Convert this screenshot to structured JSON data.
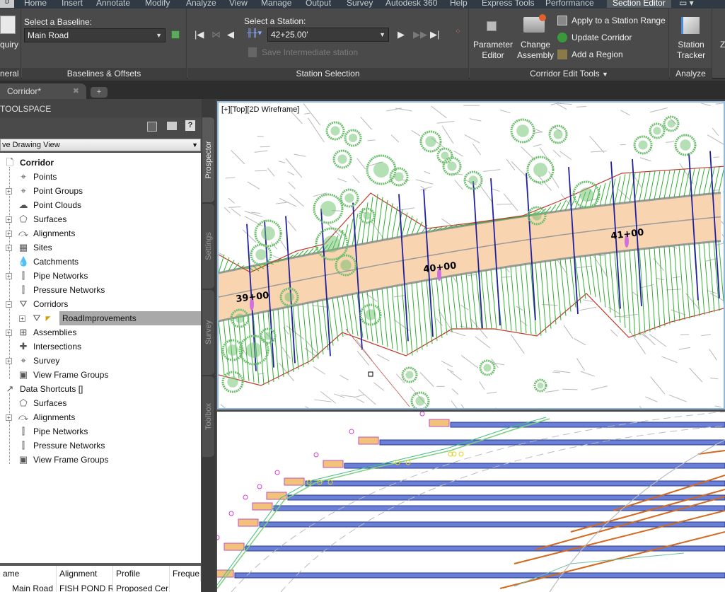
{
  "ribbon_tabs": [
    "Home",
    "Insert",
    "Annotate",
    "Modify",
    "Analyze",
    "View",
    "Manage",
    "Output",
    "Survey",
    "Autodesk 360",
    "Help",
    "Express Tools",
    "Performance",
    "Section Editor"
  ],
  "active_tab": "Section Editor",
  "app_button_label": "D",
  "panels": {
    "general": {
      "title": "neral",
      "button_label": "quiry"
    },
    "baselines": {
      "title": "Baselines & Offsets",
      "select_label": "Select a Baseline:",
      "baseline_value": "Main Road"
    },
    "station_selection": {
      "title": "Station Selection",
      "select_label": "Select a Station:",
      "station_value": "42+25.00'",
      "save_intermediate_label": "Save Intermediate station"
    },
    "corridor_edit": {
      "title": "Corridor Edit Tools",
      "parameter_editor": "Parameter Editor",
      "parameter_editor_l1": "Parameter",
      "parameter_editor_l2": "Editor",
      "change_assembly_l1": "Change",
      "change_assembly_l2": "Assembly",
      "apply_range": "Apply to a Station Range",
      "update_corridor": "Update Corridor",
      "add_region": "Add a Region"
    },
    "analyze": {
      "title": "Analyze",
      "station_tracker_l1": "Station",
      "station_tracker_l2": "Tracker"
    }
  },
  "file_tabs": [
    {
      "label": "Corridor*"
    }
  ],
  "toolspace": {
    "title": "TOOLSPACE",
    "view_dropdown": "ve Drawing View",
    "tree": [
      {
        "label": "Corridor",
        "level": 0,
        "bold": true,
        "icon": "drawing-icon"
      },
      {
        "label": "Points",
        "level": 1,
        "icon": "points-icon",
        "expander": false
      },
      {
        "label": "Point Groups",
        "level": 1,
        "icon": "point-groups-icon",
        "expander": true
      },
      {
        "label": "Point Clouds",
        "level": 1,
        "icon": "point-clouds-icon",
        "expander": false
      },
      {
        "label": "Surfaces",
        "level": 1,
        "icon": "surfaces-icon",
        "expander": true
      },
      {
        "label": "Alignments",
        "level": 1,
        "icon": "alignments-icon",
        "expander": true
      },
      {
        "label": "Sites",
        "level": 1,
        "icon": "sites-icon",
        "expander": true
      },
      {
        "label": "Catchments",
        "level": 1,
        "icon": "catchments-icon",
        "expander": false
      },
      {
        "label": "Pipe Networks",
        "level": 1,
        "icon": "pipe-networks-icon",
        "expander": true
      },
      {
        "label": "Pressure Networks",
        "level": 1,
        "icon": "pressure-networks-icon",
        "expander": false
      },
      {
        "label": "Corridors",
        "level": 1,
        "icon": "corridors-icon",
        "expander": "minus"
      },
      {
        "label": "RoadImprovements",
        "level": 2,
        "icon": "corridor-item-icon",
        "expander": true,
        "selected": true
      },
      {
        "label": "Assemblies",
        "level": 1,
        "icon": "assemblies-icon",
        "expander": true
      },
      {
        "label": "Intersections",
        "level": 1,
        "icon": "intersections-icon",
        "expander": false
      },
      {
        "label": "Survey",
        "level": 1,
        "icon": "survey-icon",
        "expander": true
      },
      {
        "label": "View Frame Groups",
        "level": 1,
        "icon": "view-frame-groups-icon",
        "expander": false
      },
      {
        "label": "Data Shortcuts []",
        "level": 0,
        "icon": "data-shortcuts-icon"
      },
      {
        "label": "Surfaces",
        "level": 1,
        "icon": "surfaces-shortcut-icon",
        "expander": false
      },
      {
        "label": "Alignments",
        "level": 1,
        "icon": "alignments-shortcut-icon",
        "expander": true
      },
      {
        "label": "Pipe Networks",
        "level": 1,
        "icon": "pipe-networks-shortcut-icon",
        "expander": false
      },
      {
        "label": "Pressure Networks",
        "level": 1,
        "icon": "pressure-networks-shortcut-icon",
        "expander": false
      },
      {
        "label": "View Frame Groups",
        "level": 1,
        "icon": "view-frame-groups-shortcut-icon",
        "expander": false
      }
    ],
    "grid": {
      "columns": [
        "ame",
        "Alignment",
        "Profile",
        "Freque"
      ],
      "rows": [
        [
          "Main Road",
          "FISH POND R",
          "Proposed Cer",
          ""
        ]
      ]
    },
    "side_tabs": [
      "Prospector",
      "Settings",
      "Survey",
      "Toolbox"
    ],
    "active_side_tab": "Prospector"
  },
  "viewport_top": {
    "label": "[+][Top][2D Wireframe]",
    "stations": [
      "39+00",
      "40+00",
      "41+00"
    ]
  },
  "colors": {
    "road_fill": "#f8d5b0",
    "sample_line": "#2020a0",
    "daylight": "#30b030",
    "boundary": "#c0392b",
    "tree": "#6cbf6c",
    "pavement": "#6a7fd8",
    "daylight_3d": "#d2691e"
  }
}
